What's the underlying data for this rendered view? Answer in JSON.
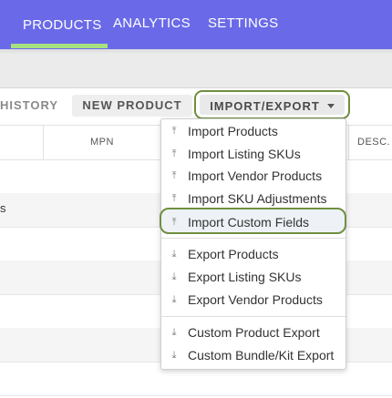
{
  "nav": {
    "tabs": [
      {
        "label": "PRODUCTS",
        "active": true
      },
      {
        "label": "ANALYTICS",
        "active": false
      },
      {
        "label": "SETTINGS",
        "active": false
      }
    ]
  },
  "toolbar": {
    "history_label": "HISTORY",
    "new_product_label": "NEW PRODUCT",
    "import_export_label": "IMPORT/EXPORT"
  },
  "table": {
    "columns": [
      "MPN",
      "DESC."
    ],
    "row_fragment": "s"
  },
  "menu": {
    "import_items": [
      {
        "label": "Import Products",
        "icon": "upload-icon"
      },
      {
        "label": "Import Listing SKUs",
        "icon": "upload-icon"
      },
      {
        "label": "Import Vendor Products",
        "icon": "upload-icon"
      },
      {
        "label": "Import SKU Adjustments",
        "icon": "upload-icon"
      },
      {
        "label": "Import Custom Fields",
        "icon": "upload-icon",
        "highlighted": true
      }
    ],
    "export_items": [
      {
        "label": "Export Products",
        "icon": "download-icon"
      },
      {
        "label": "Export Listing SKUs",
        "icon": "download-icon"
      },
      {
        "label": "Export Vendor Products",
        "icon": "download-icon"
      }
    ],
    "custom_export_items": [
      {
        "label": "Custom Product Export",
        "icon": "download-icon"
      },
      {
        "label": "Custom Bundle/Kit Export",
        "icon": "download-icon"
      }
    ]
  },
  "colors": {
    "nav_bg": "#6a6ae8",
    "active_underline": "#a7e07f",
    "highlight_border": "#6f8f3f"
  }
}
